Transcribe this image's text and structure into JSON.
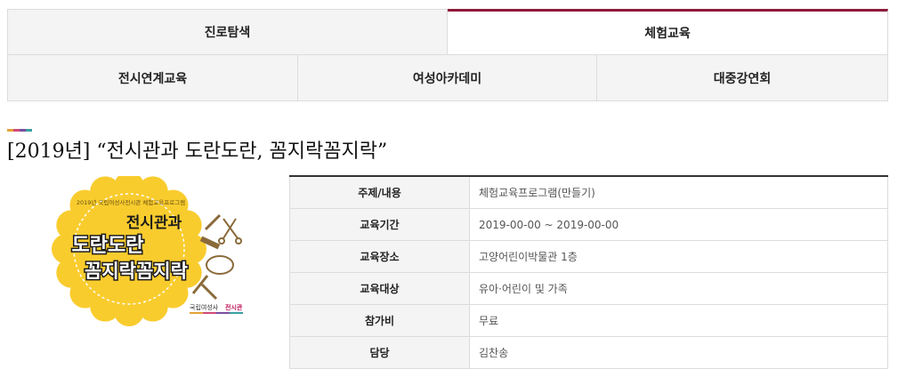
{
  "tabs": {
    "row1": [
      {
        "label": "진로탐색",
        "active": false
      },
      {
        "label": "체험교육",
        "active": true
      }
    ],
    "row2": [
      {
        "label": "전시연계교육"
      },
      {
        "label": "여성아카데미"
      },
      {
        "label": "대중강연회"
      }
    ]
  },
  "accent_colors": [
    "#e2a33a",
    "#d04b7a",
    "#7b4fa0",
    "#3aa0a0"
  ],
  "program": {
    "title": "[2019년] “전시관과 도란도란, 꼼지락꼼지락”",
    "poster": {
      "top_text": "2019년 국립여성사전시관 체험교육프로그램",
      "line1": "전시관과",
      "line2": "도란도란",
      "line3": "꼼지락꼼지락",
      "logo_small": "국립여성사",
      "logo_accent": "전시관",
      "background_color": "#f9cc2e"
    },
    "info": [
      {
        "label": "주제/내용",
        "value": "체험교육프로그램(만들기)"
      },
      {
        "label": "교육기간",
        "value": "2019-00-00 ~ 2019-00-00"
      },
      {
        "label": "교육장소",
        "value": "고양어린이박물관 1층"
      },
      {
        "label": "교육대상",
        "value": "유아·어린이 및 가족"
      },
      {
        "label": "참가비",
        "value": "무료"
      },
      {
        "label": "담당",
        "value": "김찬송"
      }
    ]
  }
}
